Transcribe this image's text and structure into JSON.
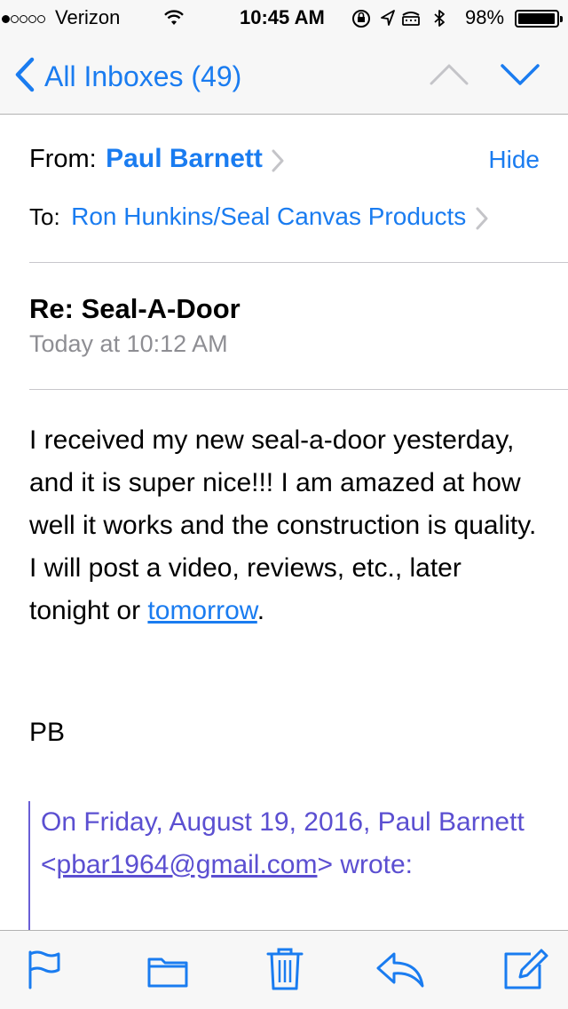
{
  "status_bar": {
    "carrier": "Verizon",
    "time": "10:45 AM",
    "battery_percent": "98%",
    "battery_level": 0.98
  },
  "nav": {
    "back_label": "All Inboxes (49)"
  },
  "header": {
    "from_label": "From:",
    "from_name": "Paul Barnett",
    "hide_label": "Hide",
    "to_label": "To:",
    "to_name": "Ron Hunkins/Seal Canvas Products",
    "subject": "Re: Seal-A-Door",
    "date": "Today at 10:12 AM"
  },
  "body": {
    "paragraph_1": "I received my new seal-a-door yesterday, and it is super nice!!! I am amazed at how well it works and the construction is quality.",
    "line_2_prefix": "I will post a video, reviews, etc., later tonight or ",
    "line_2_link": "tomorrow",
    "line_2_suffix": ".",
    "signature": "PB"
  },
  "quote": {
    "prefix": "On Friday, August 19, 2016, Paul Barnett <",
    "email_link": "pbar1964@gmail.com",
    "suffix": "> wrote:"
  },
  "toolbar": {
    "icons": [
      "flag-icon",
      "folder-icon",
      "trash-icon",
      "reply-icon",
      "compose-icon"
    ]
  },
  "colors": {
    "accent": "#1a7cf0",
    "quote": "#5b4fd1",
    "secondary_text": "#8e8e93"
  }
}
